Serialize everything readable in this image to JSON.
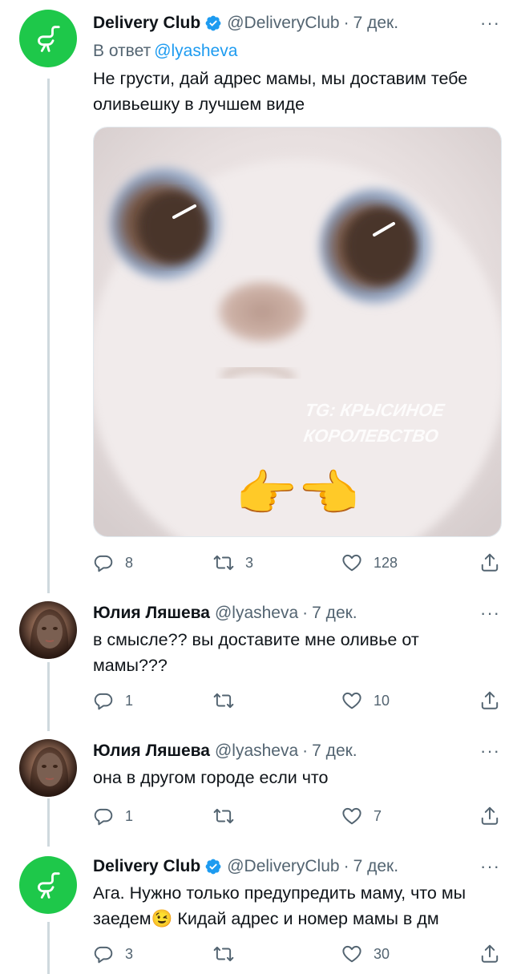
{
  "colors": {
    "brand_green": "#1ec84a",
    "link_blue": "#1d9bf0",
    "muted": "#536471"
  },
  "tweets": [
    {
      "author": "Delivery Club",
      "handle": "@DeliveryClub",
      "date": "7 дек.",
      "verified": true,
      "reply_prefix": "В ответ",
      "reply_mention": "@lyasheva",
      "text_lines": [
        "Не грусти, дай адрес мамы, мы доставим тебе",
        "оливьешку в лучшем виде"
      ],
      "media": {
        "watermark_line1": "TG: КРЫСИНОЕ",
        "watermark_line2": "КОРОЛЕВСТВО",
        "emoji": "👉👈"
      },
      "replies": "8",
      "retweets": "3",
      "likes": "128"
    },
    {
      "author": "Юлия Ляшева",
      "handle": "@lyasheva",
      "date": "7 дек.",
      "text_lines": [
        "в смысле?? вы доставите мне оливье от",
        "мамы???"
      ],
      "replies": "1",
      "retweets": "",
      "likes": "10"
    },
    {
      "author": "Юлия Ляшева",
      "handle": "@lyasheva",
      "date": "7 дек.",
      "text_lines": [
        "она в другом городе если что"
      ],
      "replies": "1",
      "retweets": "",
      "likes": "7"
    },
    {
      "author": "Delivery Club",
      "handle": "@DeliveryClub",
      "date": "7 дек.",
      "verified": true,
      "text_lines": [
        "Ага. Нужно только предупредить маму, что мы",
        "заедем😉 Кидай адрес и номер мамы в дм"
      ],
      "replies": "3",
      "retweets": "",
      "likes": "30"
    }
  ],
  "more_glyph": "···",
  "dot_glyph": "·"
}
